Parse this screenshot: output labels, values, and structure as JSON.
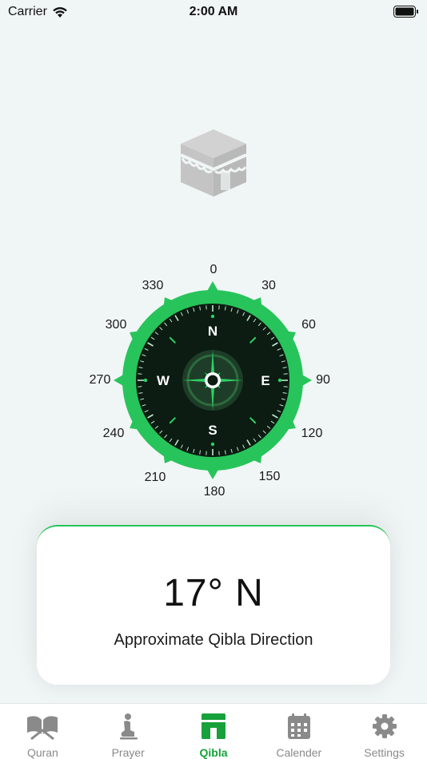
{
  "status": {
    "carrier": "Carrier",
    "time": "2:00 AM"
  },
  "compass": {
    "degree_labels": [
      "0",
      "30",
      "60",
      "90",
      "120",
      "150",
      "180",
      "210",
      "240",
      "270",
      "300",
      "330"
    ],
    "cardinals": {
      "north": "N",
      "east": "E",
      "south": "S",
      "west": "W"
    },
    "colors": {
      "ring": "#27c45b",
      "face": "#0c1c12",
      "accent": "#2fd065"
    }
  },
  "qibla": {
    "value": "17° N",
    "caption": "Approximate Qibla Direction"
  },
  "tabs": [
    {
      "label": "Quran",
      "icon": "quran-book-icon",
      "active": false
    },
    {
      "label": "Prayer",
      "icon": "prayer-person-icon",
      "active": false
    },
    {
      "label": "Qibla",
      "icon": "kaaba-icon",
      "active": true
    },
    {
      "label": "Calender",
      "icon": "calendar-icon",
      "active": false
    },
    {
      "label": "Settings",
      "icon": "gear-icon",
      "active": false
    }
  ],
  "theme": {
    "active_color": "#17a13a",
    "inactive_color": "#8a8a8a"
  }
}
